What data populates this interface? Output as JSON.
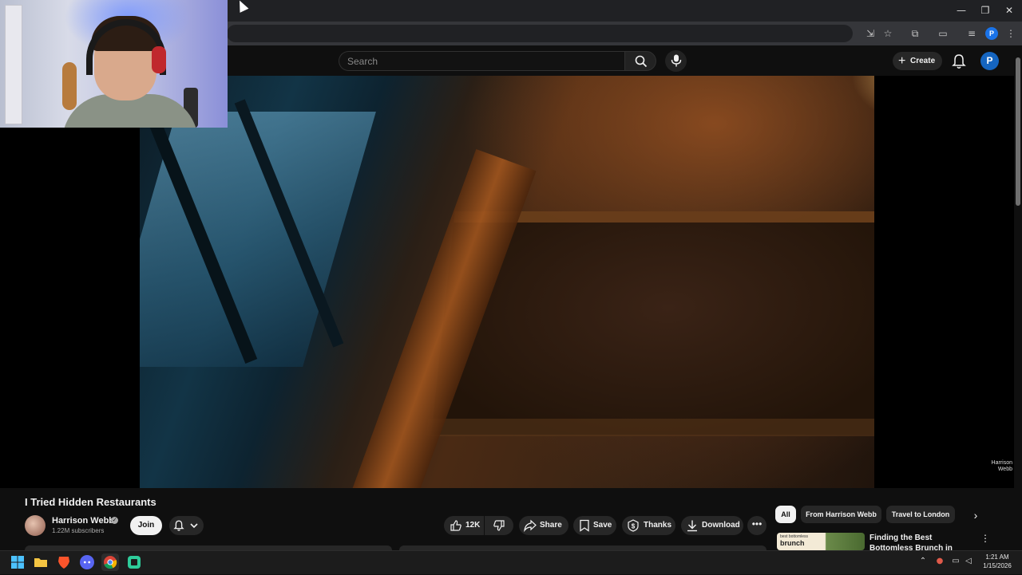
{
  "search": {
    "placeholder": "Search"
  },
  "header": {
    "create_label": "Create",
    "avatar_letter": "P"
  },
  "browser": {
    "profile_letter": "P"
  },
  "video": {
    "title": "I Tried Hidden Restaurants",
    "watermark_line1": "Harrison",
    "watermark_line2": "Webb"
  },
  "channel": {
    "name": "Harrison Webb",
    "subscribers": "1.22M subscribers",
    "join_label": "Join"
  },
  "actions": {
    "like_count": "12K",
    "share_label": "Share",
    "save_label": "Save",
    "thanks_label": "Thanks",
    "download_label": "Download",
    "more_label": "•••"
  },
  "chips": {
    "all": "All",
    "from_channel": "From Harrison Webb",
    "travel": "Travel to London"
  },
  "recommendation": {
    "thumb_small": "best bottomless",
    "thumb_big": "brunch",
    "title": "Finding the Best Bottomless Brunch in London"
  },
  "taskbar": {
    "time": "1:21 AM",
    "date": "1/15/2026"
  },
  "colors": {
    "background": "#0f0f0f",
    "chip_active": "#f1f1f1",
    "pill": "#272727",
    "accent_blue": "#1565c0"
  }
}
